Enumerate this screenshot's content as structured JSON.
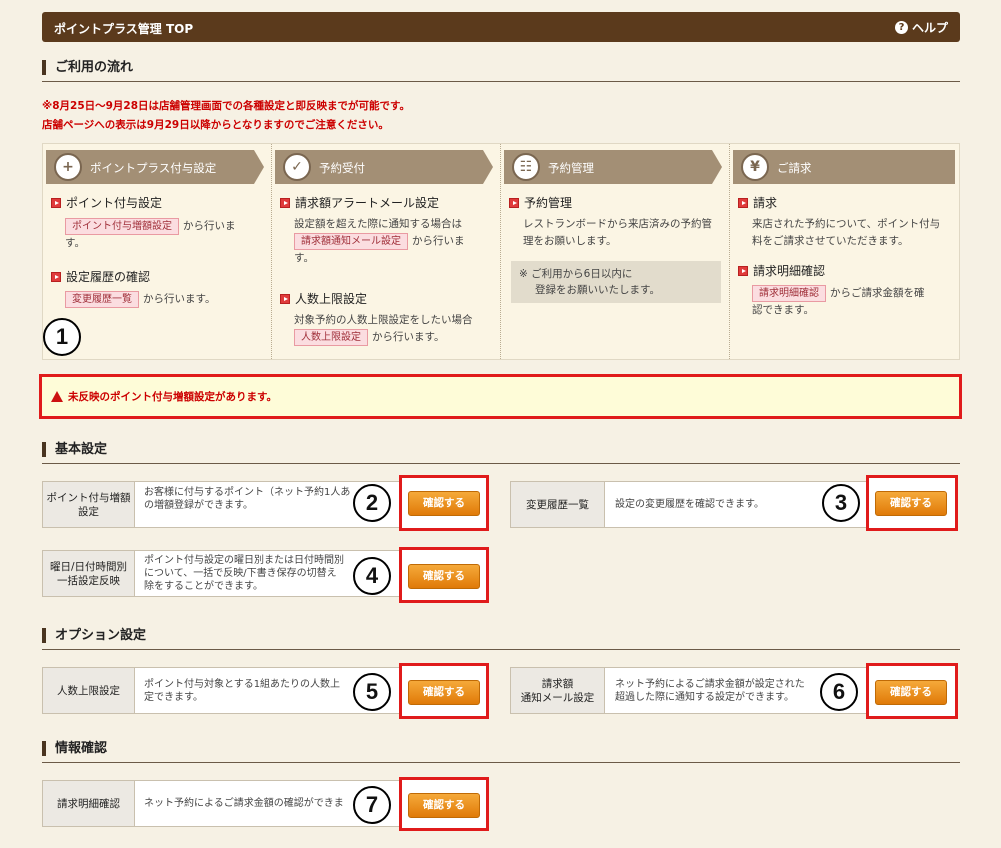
{
  "header": {
    "title": "ポイントプラス管理 TOP",
    "help_label": "ヘルプ",
    "help_icon": "?"
  },
  "flow_section": {
    "title": "ご利用の流れ"
  },
  "notice": {
    "line1": "※8月25日～9月28日は店舗管理画面での各種設定と即反映までが可能です。",
    "line2": "店舗ページへの表示は9月29日以降からとなりますのでご注意ください。"
  },
  "flow": [
    {
      "head": "ポイントプラス付与設定",
      "icon": "+",
      "items": [
        {
          "title": "ポイント付与設定",
          "tag": "ポイント付与増額設定",
          "text_after": "から行いま",
          "text_cont": "す。"
        },
        {
          "title": "設定履歴の確認",
          "tag": "変更履歴一覧",
          "text_after": "から行います。"
        }
      ]
    },
    {
      "head": "予約受付",
      "icon": "✓",
      "items": [
        {
          "title": "請求額アラートメール設定",
          "text_before": "設定額を超えた際に通知する場合は",
          "tag": "請求額通知メール設定",
          "text_after": "から行いま",
          "text_cont": "す。"
        },
        {
          "title": "人数上限設定",
          "text_before": "対象予約の人数上限設定をしたい場合",
          "tag": "人数上限設定",
          "text_after": "から行います。"
        }
      ]
    },
    {
      "head": "予約管理",
      "icon": "☷",
      "items": [
        {
          "title": "予約管理",
          "text_before": "レストランボードから来店済みの予約管",
          "text_cont": "理をお願いします。"
        }
      ],
      "note_line1": "※ ご利用から6日以内に",
      "note_line2": "登録をお願いいたします。"
    },
    {
      "head": "ご請求",
      "icon": "¥",
      "items": [
        {
          "title": "請求",
          "text_before": "来店された予約について、ポイント付与",
          "text_cont": "料をご請求させていただきます。"
        },
        {
          "title": "請求明細確認",
          "tag": "請求明細確認",
          "text_after": "からご請求金額を確",
          "text_cont": "認できます。"
        }
      ]
    }
  ],
  "warning": {
    "text": "未反映のポイント付与増額設定があります。"
  },
  "sections": {
    "basic": "基本設定",
    "option": "オプション設定",
    "info": "情報確認"
  },
  "cards": {
    "c2": {
      "label": "ポイント付与増額\n設定",
      "desc": "お客様に付与するポイント（ネット予約1人あ\nの増額登録ができます。"
    },
    "c3": {
      "label": "変更履歴一覧",
      "desc": "設定の変更履歴を確認できます。"
    },
    "c4": {
      "label": "曜日/日付時間別\n一括設定反映",
      "desc": "ポイント付与設定の曜日別または日付時間別\nについて、一括で反映/下書き保存の切替え\n除をすることができます。"
    },
    "c5": {
      "label": "人数上限設定",
      "desc": "ポイント付与対象とする1組あたりの人数上\n定できます。"
    },
    "c6": {
      "label": "請求額\n通知メール設定",
      "desc": "ネット予約によるご請求金額が設定された\n超過した際に通知する設定ができます。"
    },
    "c7": {
      "label": "請求明細確認",
      "desc": "ネット予約によるご請求金額の確認ができま"
    }
  },
  "button_label": "確認する",
  "markers": [
    "1",
    "2",
    "3",
    "4",
    "5",
    "6",
    "7"
  ],
  "colors": {
    "header_bg": "#5b3a1c",
    "accent_red": "#e01b1b",
    "button_orange": "#e98a14",
    "page_bg": "#f6f1e4"
  },
  "icons": {
    "help": "help-circle-icon",
    "warning": "warning-triangle-icon",
    "bullet": "red-arrow-square-icon"
  }
}
